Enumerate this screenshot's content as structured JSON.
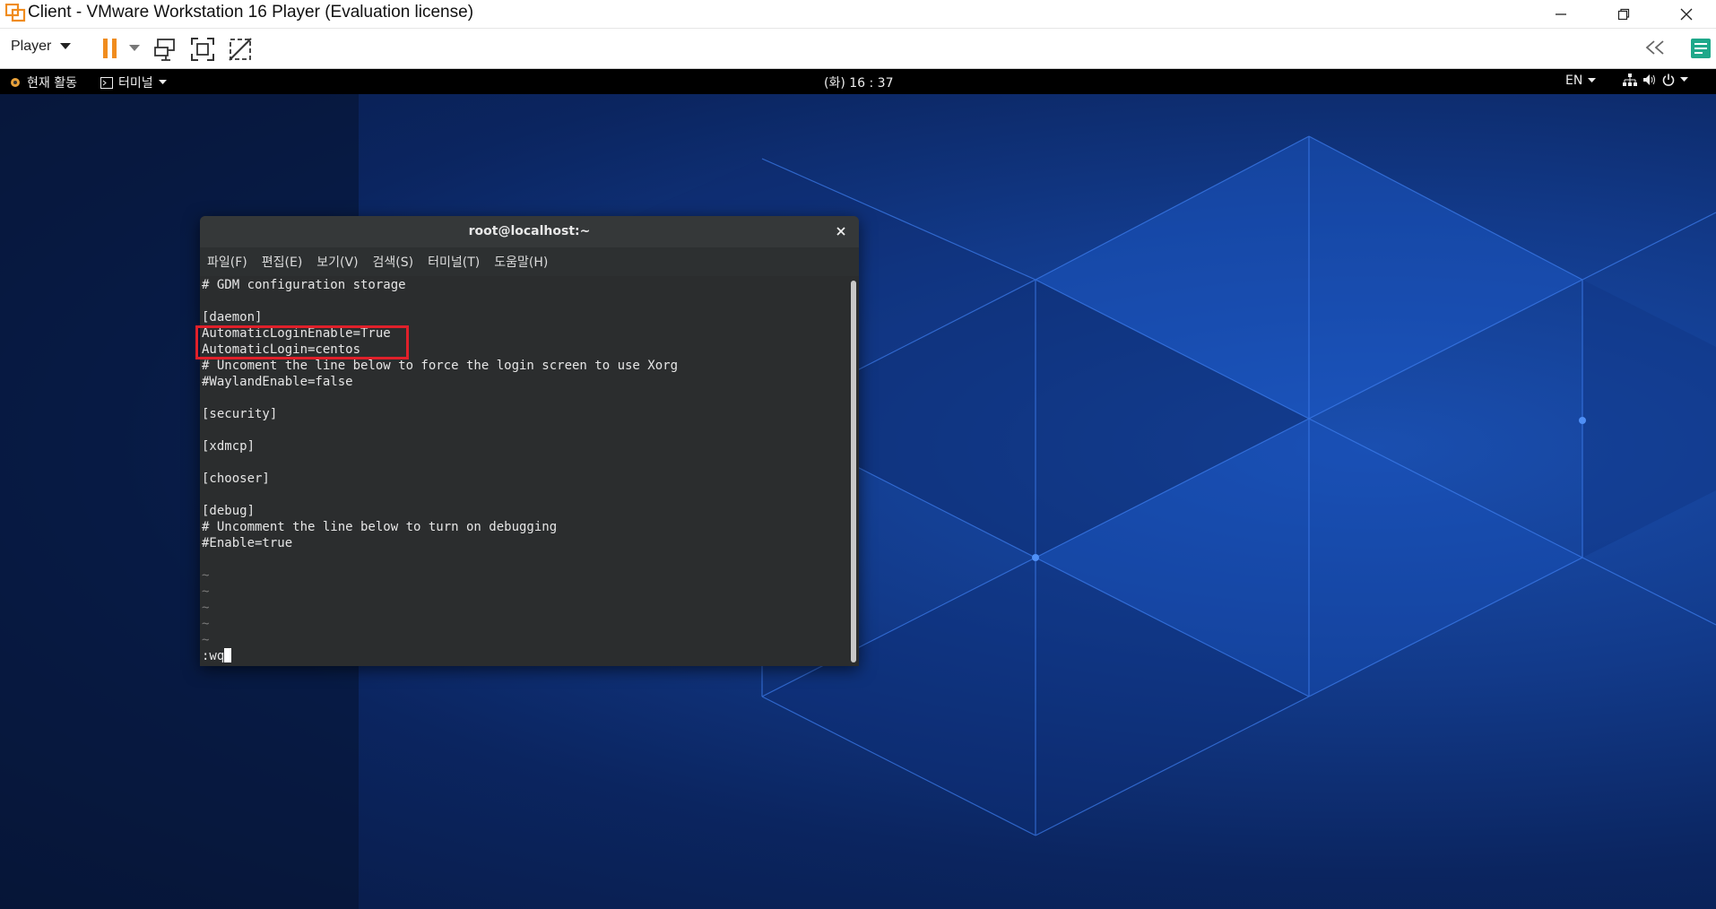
{
  "window": {
    "title": "Client - VMware Workstation 16 Player (Evaluation license)",
    "controls": [
      "minimize-icon",
      "restore-icon",
      "close-icon"
    ]
  },
  "toolbar": {
    "player_label": "Player",
    "icons": [
      "pause-icon",
      "dropdown-icon",
      "send-ctrl-alt-del-icon",
      "fullscreen-icon",
      "unity-icon",
      "collapse-left-icon",
      "notes-icon"
    ]
  },
  "gnome_bar": {
    "activities": "현재 활동",
    "app_menu": "터미널",
    "clock": "(화) 16 : 37",
    "language": "EN",
    "status_icons": [
      "network-icon",
      "volume-icon",
      "power-icon"
    ]
  },
  "terminal": {
    "title": "root@localhost:~",
    "menu": [
      "파일(F)",
      "편집(E)",
      "보기(V)",
      "검색(S)",
      "터미널(T)",
      "도움말(H)"
    ],
    "lines": [
      "# GDM configuration storage",
      "",
      "[daemon]",
      "AutomaticLoginEnable=True",
      "AutomaticLogin=centos",
      "# Uncoment the line below to force the login screen to use Xorg",
      "#WaylandEnable=false",
      "",
      "[security]",
      "",
      "[xdmcp]",
      "",
      "[chooser]",
      "",
      "[debug]",
      "# Uncomment the line below to turn on debugging",
      "#Enable=true",
      "",
      "~",
      "~",
      "~",
      "~",
      "~"
    ],
    "command_line": ":wq"
  },
  "colors": {
    "highlight": "#e0202a",
    "accent_orange": "#f08c1e",
    "desktop_blue": "#123a8a"
  }
}
